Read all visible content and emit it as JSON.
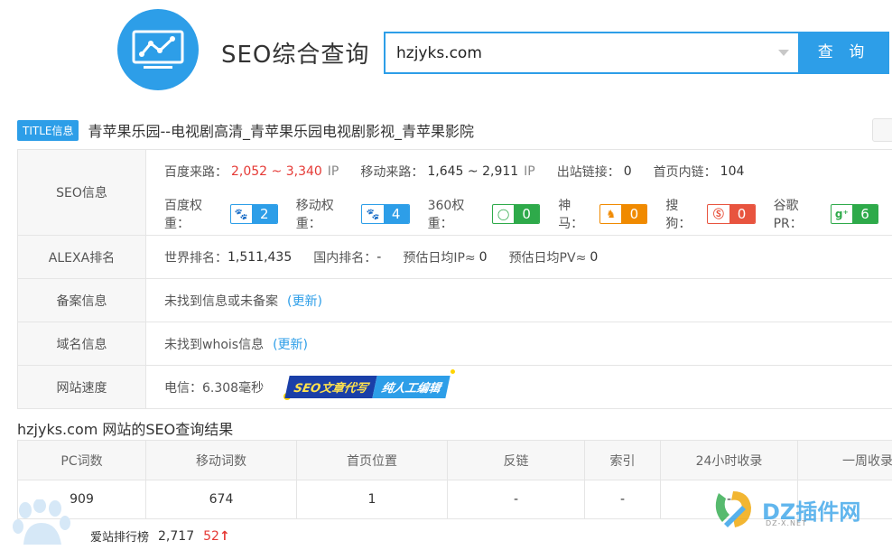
{
  "header": {
    "site_title": "SEO综合查询",
    "search_value": "hzjyks.com",
    "search_button": "查 询"
  },
  "title_row": {
    "badge": "TITLE信息",
    "text": "青苹果乐园--电视剧高清_青苹果乐园电视剧影视_青苹果影院"
  },
  "seo": {
    "label": "SEO信息",
    "baidu_traffic_label": "百度来路：",
    "baidu_traffic_value": "2,052 ~ 3,340",
    "baidu_traffic_unit": "IP",
    "mobile_traffic_label": "移动来路：",
    "mobile_traffic_value": "1,645 ~ 2,911",
    "mobile_traffic_unit": "IP",
    "outlinks_label": "出站链接：",
    "outlinks_value": "0",
    "inlinks_label": "首页内链：",
    "inlinks_value": "104",
    "ranks": [
      {
        "label": "百度权重：",
        "value": "2",
        "color": "#2d9ee8"
      },
      {
        "label": "移动权重：",
        "value": "4",
        "color": "#2d9ee8"
      },
      {
        "label": "360权重：",
        "value": "0",
        "color": "#2eaa4a"
      },
      {
        "label": "神马：",
        "value": "0",
        "color": "#f08a00"
      },
      {
        "label": "搜狗：",
        "value": "0",
        "color": "#e8543f"
      },
      {
        "label": "谷歌PR：",
        "value": "6",
        "color": "#2eaa4a"
      }
    ]
  },
  "alexa": {
    "label": "ALEXA排名",
    "world_label": "世界排名：",
    "world_value": "1,511,435",
    "domestic_label": "国内排名：",
    "domestic_value": "-",
    "ip_label": "预估日均IP≈",
    "ip_value": "0",
    "pv_label": "预估日均PV≈",
    "pv_value": "0"
  },
  "beian": {
    "label": "备案信息",
    "text": "未找到信息或未备案",
    "update": "(更新)"
  },
  "domain": {
    "label": "域名信息",
    "text": "未找到whois信息",
    "update": "(更新)"
  },
  "speed": {
    "label": "网站速度",
    "text": "电信：6.308毫秒",
    "promo1": "SEO文章代写",
    "promo2": "纯人工编辑"
  },
  "results": {
    "title": "hzjyks.com 网站的SEO查询结果",
    "headers": [
      "PC词数",
      "移动词数",
      "首页位置",
      "反链",
      "索引",
      "24小时收录",
      "一周收录"
    ],
    "row": [
      "909",
      "674",
      "1",
      "-",
      "-",
      "-",
      ""
    ]
  },
  "bottom": {
    "label": "爱站排行榜",
    "value": "2,717",
    "change": "52",
    "arrow": "↑"
  },
  "watermark": {
    "text": "DZ插件网",
    "sub": "DZ-X.NET"
  }
}
